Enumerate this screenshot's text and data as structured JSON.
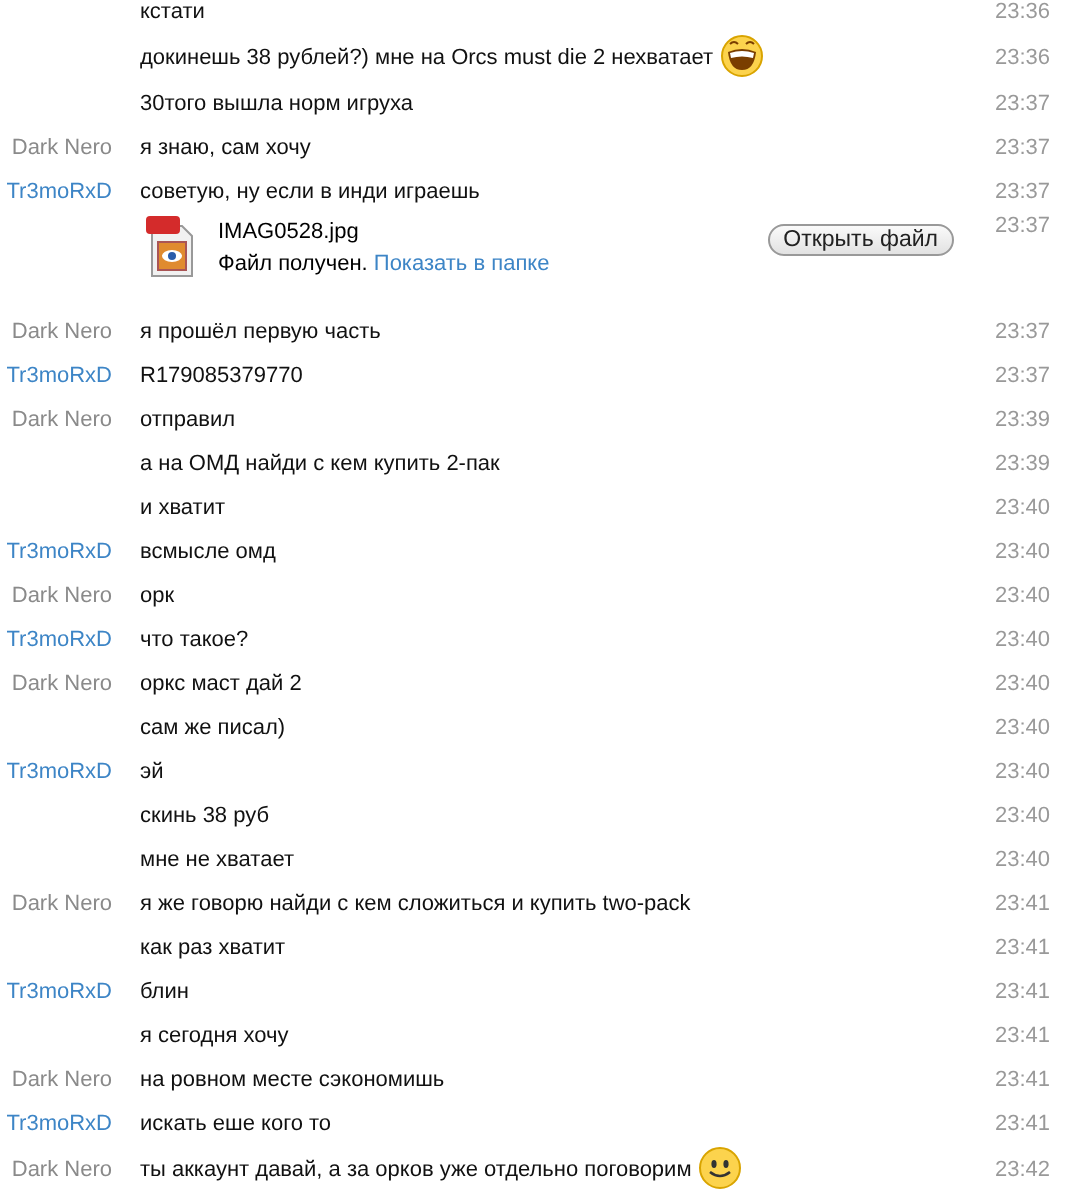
{
  "messages": [
    {
      "kind": "text",
      "text": "кстати",
      "time": "23:36"
    },
    {
      "kind": "text",
      "text": "докинешь 38 рублей?) мне на Orcs must die 2 нехватает",
      "emoticon": {
        "kind": "laugh"
      },
      "time": "23:36"
    },
    {
      "kind": "text",
      "text": "30того вышла норм игруха",
      "time": "23:37"
    },
    {
      "kind": "text",
      "sender": "Dark Nero",
      "color": "#8a8a8a",
      "text": "я знаю, сам хочу",
      "time": "23:37"
    },
    {
      "kind": "text",
      "sender": "Tr3moRxD",
      "color": "#3d85c6",
      "text": "советую, ну если в инди играешь",
      "time": "23:37"
    },
    {
      "kind": "file",
      "filename": "IMAG0528.jpg",
      "status": "Файл получен.",
      "link": "Показать в папке",
      "button": "Открыть файл",
      "time": "23:37"
    },
    {
      "kind": "text",
      "sender": "Dark Nero",
      "color": "#8a8a8a",
      "text": "я прошёл первую часть",
      "time": "23:37"
    },
    {
      "kind": "text",
      "sender": "Tr3moRxD",
      "color": "#3d85c6",
      "text": "R179085379770",
      "time": "23:37"
    },
    {
      "kind": "text",
      "sender": "Dark Nero",
      "color": "#8a8a8a",
      "text": "отправил",
      "time": "23:39"
    },
    {
      "kind": "text",
      "text": "а на ОМД найди с кем купить 2-пак",
      "time": "23:39"
    },
    {
      "kind": "text",
      "text": "и хватит",
      "time": "23:40"
    },
    {
      "kind": "text",
      "sender": "Tr3moRxD",
      "color": "#3d85c6",
      "text": "всмысле омд",
      "time": "23:40"
    },
    {
      "kind": "text",
      "sender": "Dark Nero",
      "color": "#8a8a8a",
      "text": "орк",
      "time": "23:40"
    },
    {
      "kind": "text",
      "sender": "Tr3moRxD",
      "color": "#3d85c6",
      "text": "что такое?",
      "time": "23:40"
    },
    {
      "kind": "text",
      "sender": "Dark Nero",
      "color": "#8a8a8a",
      "text": "оркс маст дай 2",
      "time": "23:40"
    },
    {
      "kind": "text",
      "text": "сам же писал)",
      "time": "23:40"
    },
    {
      "kind": "text",
      "sender": "Tr3moRxD",
      "color": "#3d85c6",
      "text": "эй",
      "time": "23:40"
    },
    {
      "kind": "text",
      "text": "скинь 38 руб",
      "time": "23:40"
    },
    {
      "kind": "text",
      "text": "мне не хватает",
      "time": "23:40"
    },
    {
      "kind": "text",
      "sender": "Dark Nero",
      "color": "#8a8a8a",
      "text": "я же говорю найди с кем сложиться и купить two-pack",
      "time": "23:41"
    },
    {
      "kind": "text",
      "text": "как раз хватит",
      "time": "23:41"
    },
    {
      "kind": "text",
      "sender": "Tr3moRxD",
      "color": "#3d85c6",
      "text": "блин",
      "time": "23:41"
    },
    {
      "kind": "text",
      "text": "я сегодня хочу",
      "time": "23:41"
    },
    {
      "kind": "text",
      "sender": "Dark Nero",
      "color": "#8a8a8a",
      "text": "на ровном месте сэкономишь",
      "time": "23:41"
    },
    {
      "kind": "text",
      "sender": "Tr3moRxD",
      "color": "#3d85c6",
      "text": "искать еше кого то",
      "time": "23:41"
    },
    {
      "kind": "text",
      "sender": "Dark Nero",
      "color": "#8a8a8a",
      "text": "ты аккаунт давай, а за орков уже отдельно поговорим",
      "emoticon": {
        "kind": "smile"
      },
      "time": "23:42"
    }
  ]
}
